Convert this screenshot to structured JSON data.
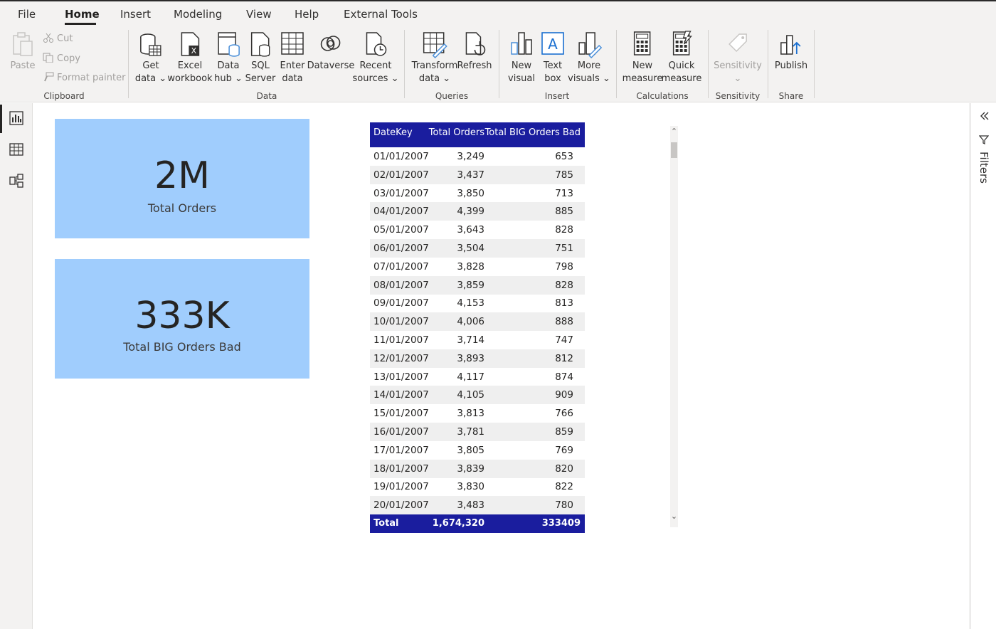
{
  "menu": {
    "tabs": [
      "File",
      "Home",
      "Insert",
      "Modeling",
      "View",
      "Help",
      "External Tools"
    ]
  },
  "ribbon": {
    "clipboard": {
      "paste": "Paste",
      "cut": "Cut",
      "copy": "Copy",
      "format_painter": "Format painter",
      "label": "Clipboard"
    },
    "data": {
      "get_data": [
        "Get",
        "data ⌄"
      ],
      "excel": [
        "Excel",
        "workbook"
      ],
      "data_hub": [
        "Data",
        "hub ⌄"
      ],
      "sql": [
        "SQL",
        "Server"
      ],
      "enter_data": [
        "Enter",
        "data"
      ],
      "dataverse": [
        "Dataverse"
      ],
      "recent": [
        "Recent",
        "sources ⌄"
      ],
      "label": "Data"
    },
    "queries": {
      "transform": [
        "Transform",
        "data ⌄"
      ],
      "refresh": [
        "Refresh"
      ],
      "label": "Queries"
    },
    "insert": {
      "new_visual": [
        "New",
        "visual"
      ],
      "text_box": [
        "Text",
        "box"
      ],
      "more_visuals": [
        "More",
        "visuals ⌄"
      ],
      "label": "Insert"
    },
    "calculations": {
      "new_measure": [
        "New",
        "measure"
      ],
      "quick_measure": [
        "Quick",
        "measure"
      ],
      "label": "Calculations"
    },
    "sensitivity": {
      "button": [
        "Sensitivity",
        "⌄"
      ],
      "label": "Sensitivity"
    },
    "share": {
      "publish": [
        "Publish"
      ],
      "label": "Share"
    }
  },
  "filters_pane": {
    "label": "Filters"
  },
  "cards": [
    {
      "value": "2M",
      "label": "Total Orders"
    },
    {
      "value": "333K",
      "label": "Total BIG Orders Bad"
    }
  ],
  "table": {
    "headers": [
      "DateKey",
      "Total Orders",
      "Total BIG Orders Bad"
    ],
    "rows": [
      [
        "01/01/2007",
        "3,249",
        "653"
      ],
      [
        "02/01/2007",
        "3,437",
        "785"
      ],
      [
        "03/01/2007",
        "3,850",
        "713"
      ],
      [
        "04/01/2007",
        "4,399",
        "885"
      ],
      [
        "05/01/2007",
        "3,643",
        "828"
      ],
      [
        "06/01/2007",
        "3,504",
        "751"
      ],
      [
        "07/01/2007",
        "3,828",
        "798"
      ],
      [
        "08/01/2007",
        "3,859",
        "828"
      ],
      [
        "09/01/2007",
        "4,153",
        "813"
      ],
      [
        "10/01/2007",
        "4,006",
        "888"
      ],
      [
        "11/01/2007",
        "3,714",
        "747"
      ],
      [
        "12/01/2007",
        "3,893",
        "812"
      ],
      [
        "13/01/2007",
        "4,117",
        "874"
      ],
      [
        "14/01/2007",
        "4,105",
        "909"
      ],
      [
        "15/01/2007",
        "3,813",
        "766"
      ],
      [
        "16/01/2007",
        "3,781",
        "859"
      ],
      [
        "17/01/2007",
        "3,805",
        "769"
      ],
      [
        "18/01/2007",
        "3,839",
        "820"
      ],
      [
        "19/01/2007",
        "3,830",
        "822"
      ],
      [
        "20/01/2007",
        "3,483",
        "780"
      ]
    ],
    "total": [
      "Total",
      "1,674,320",
      "333409"
    ]
  },
  "colors": {
    "card_fill": "#a0cdfd",
    "table_header": "#1a1d9e",
    "ribbon_bg": "#f3f2f1"
  }
}
